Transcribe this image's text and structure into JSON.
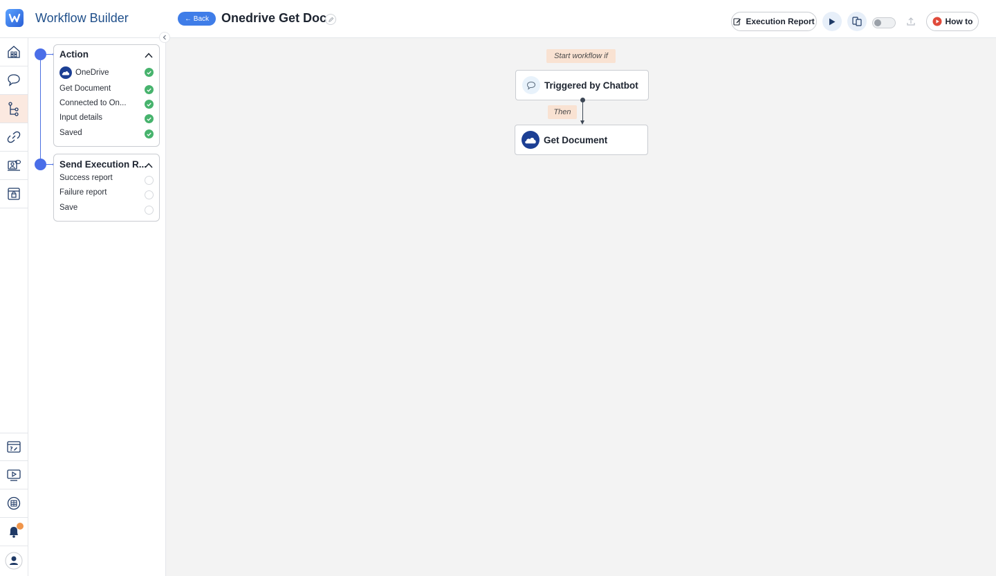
{
  "header": {
    "app_title": "Workflow Builder",
    "back_label": "← Back",
    "workflow_title": "Onedrive Get Doc",
    "execution_report_label": "Execution Report",
    "how_to_label": "How to",
    "toggle_on": false
  },
  "rail": {
    "items": [
      "home-icon",
      "chat-icon",
      "workflow-icon",
      "link-icon",
      "agent-icon",
      "store-icon"
    ],
    "bottom_items": [
      "help-icon",
      "video-icon",
      "docs-icon",
      "bell-icon",
      "avatar-icon"
    ],
    "active": "workflow-icon"
  },
  "steps": [
    {
      "title": "Action",
      "status": "complete",
      "items": [
        {
          "label": "OneDrive",
          "done": true
        },
        {
          "label": "Get Document",
          "done": true
        },
        {
          "label": "Connected to On...",
          "done": true
        },
        {
          "label": "Input details",
          "done": true
        },
        {
          "label": "Saved",
          "done": true
        }
      ]
    },
    {
      "title": "Send Execution R...",
      "status": "pending",
      "items": [
        {
          "label": "Success report",
          "done": false
        },
        {
          "label": "Failure report",
          "done": false
        },
        {
          "label": "Save",
          "done": false
        }
      ]
    }
  ],
  "canvas": {
    "start_tag": "Start workflow if",
    "trigger_label": "Triggered by Chatbot",
    "then_tag": "Then",
    "action_label": "Get Document"
  },
  "colors": {
    "accent": "#3f7de8",
    "step_dot": "#4a6ee8",
    "check": "#47b36d",
    "tag_bg": "#f9e2d2",
    "onedrive_bg": "#1c3f94"
  }
}
